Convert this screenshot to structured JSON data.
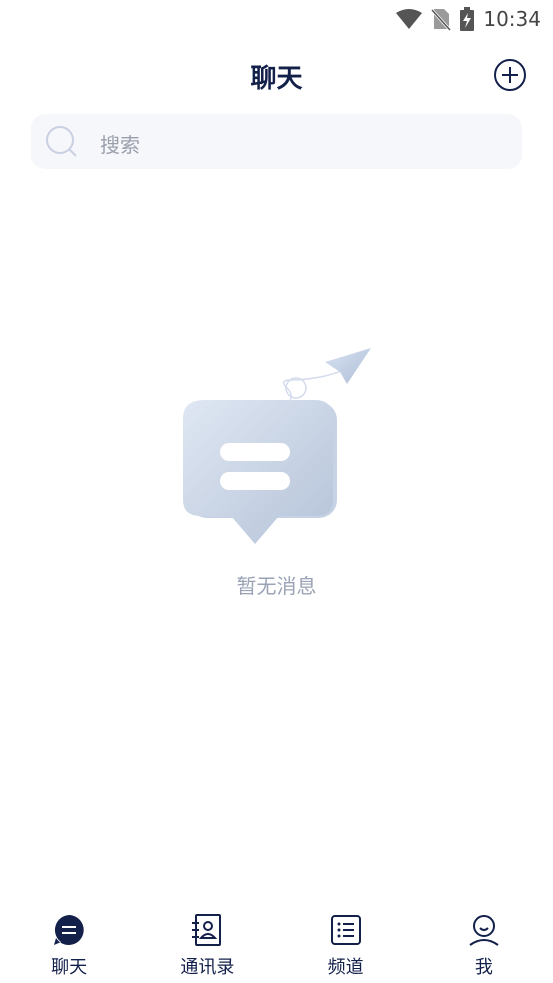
{
  "status_bar": {
    "time": "10:34"
  },
  "header": {
    "title": "聊天"
  },
  "search": {
    "placeholder": "搜索"
  },
  "empty_state": {
    "message": "暂无消息"
  },
  "tabbar": {
    "items": [
      {
        "label": "聊天",
        "icon": "chat-bubble-icon",
        "active": true
      },
      {
        "label": "通讯录",
        "icon": "contacts-book-icon",
        "active": false
      },
      {
        "label": "频道",
        "icon": "channel-list-icon",
        "active": false
      },
      {
        "label": "我",
        "icon": "profile-icon",
        "active": false
      }
    ]
  },
  "colors": {
    "primary": "#13204a",
    "muted": "#9aa3b5",
    "search_bg": "#f6f7fb"
  }
}
